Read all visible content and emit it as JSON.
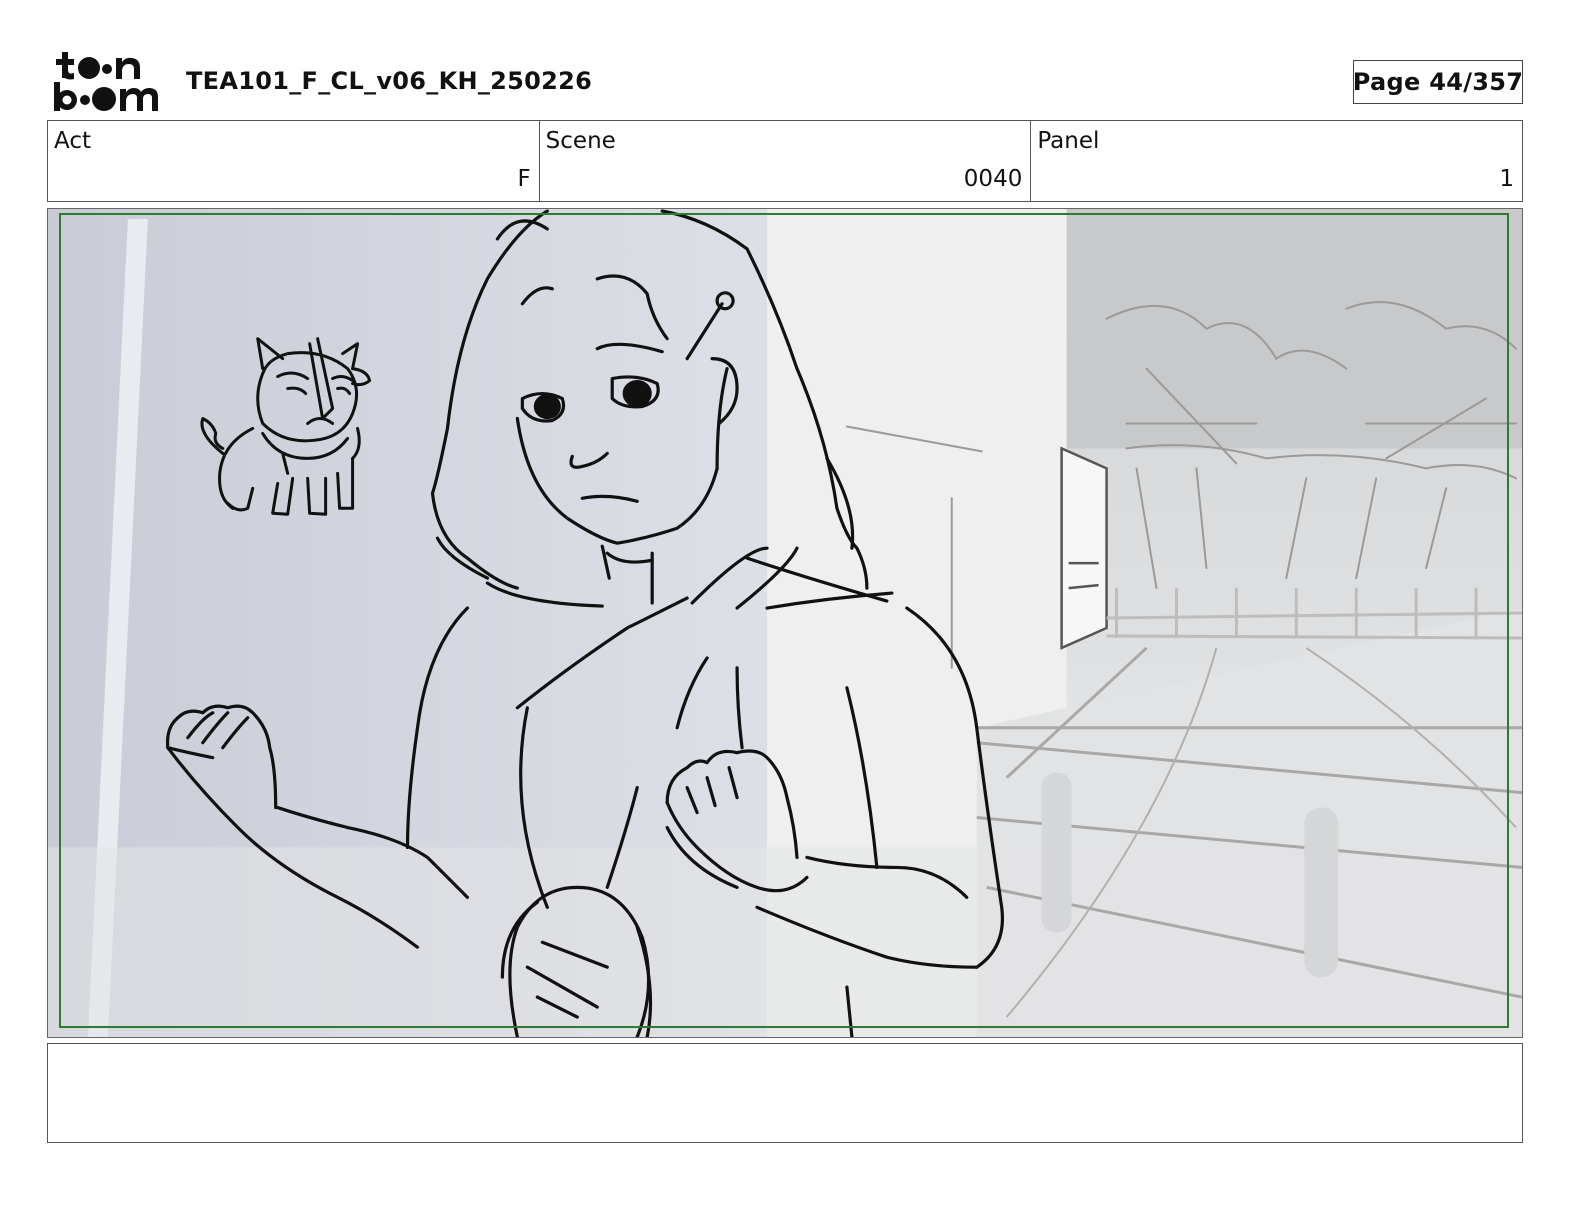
{
  "header": {
    "logo_text": "toon boom",
    "document_title": "TEA101_F_CL_v06_KH_250226",
    "page_label": "Page",
    "page_number": "44/357"
  },
  "info": {
    "act": {
      "label": "Act",
      "value": "F"
    },
    "scene": {
      "label": "Scene",
      "value": "0040"
    },
    "panel": {
      "label": "Panel",
      "value": "1"
    }
  },
  "notes": {
    "text": ""
  },
  "colors": {
    "safe_frame": "#2f7a2f",
    "sketch_line": "#111111",
    "background_wall": "#d9dce3",
    "background_floor": "#e4e6e9"
  },
  "icons": {
    "logo": "toon-boom-logo"
  }
}
